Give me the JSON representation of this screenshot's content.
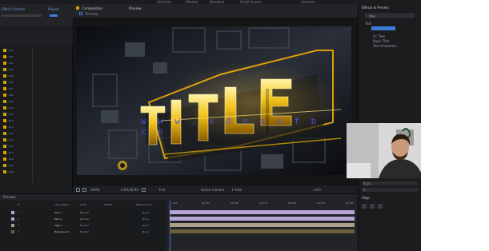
{
  "menubar": {
    "items": [
      "Selection",
      "Window",
      "Standard",
      "Small Screen",
      "Libraries"
    ]
  },
  "project": {
    "tab_label": "Effect Controls",
    "tab_label2": "Project",
    "files": [
      "001",
      "002",
      "003",
      "004",
      "005",
      "006",
      "007",
      "008",
      "009",
      "010",
      "011",
      "012",
      "013",
      "014",
      "015",
      "016",
      "017",
      "018",
      "019",
      "020"
    ]
  },
  "composition": {
    "tab_label": "Composition",
    "comp_name": "Preview",
    "breadcrumb": "Preview",
    "viewer_label": "Preview"
  },
  "viewer": {
    "watermark": "w w w . x d n x x f b . c n",
    "title_letters": "TITLE",
    "zoom": "100%",
    "resolution": "Full",
    "timecode": "0;00;00;00",
    "camera": "Active Camera",
    "views": "1 View",
    "exposure": "+0.0"
  },
  "right_panel": {
    "panel_title": "Effects & Presets",
    "search_value": "title",
    "group_label": "Text",
    "items": [
      "CC Text",
      "Basic Title",
      "Text Animation"
    ]
  },
  "character_panel": {
    "title": "Align",
    "font_size": "4 px",
    "tracking": "0"
  },
  "timeline": {
    "tab_label": "Preview",
    "col_headers": [
      "#",
      "Layer Name",
      "Mode",
      "TrkMat",
      "Parent & Link"
    ],
    "ruler_ticks": [
      "00f",
      "00:15f",
      "01:00f",
      "01:15f",
      "02:00f",
      "02:15f",
      "03:00f"
    ],
    "layers": [
      {
        "num": "1",
        "name": "Text 1",
        "mode": "Normal",
        "parent": "None",
        "color": "#b7a7d6"
      },
      {
        "num": "2",
        "name": "Text 2",
        "mode": "Normal",
        "parent": "None",
        "color": "#b7a7d6"
      },
      {
        "num": "3",
        "name": "Light 1",
        "mode": "Normal",
        "parent": "None",
        "color": "#a6a08a"
      },
      {
        "num": "4",
        "name": "Background",
        "mode": "Normal",
        "parent": "None",
        "color": "#6a5d40"
      }
    ]
  },
  "colors": {
    "accent": "#3d7bd9",
    "gold": "#f0b400",
    "watermark": "#4d52e6"
  }
}
